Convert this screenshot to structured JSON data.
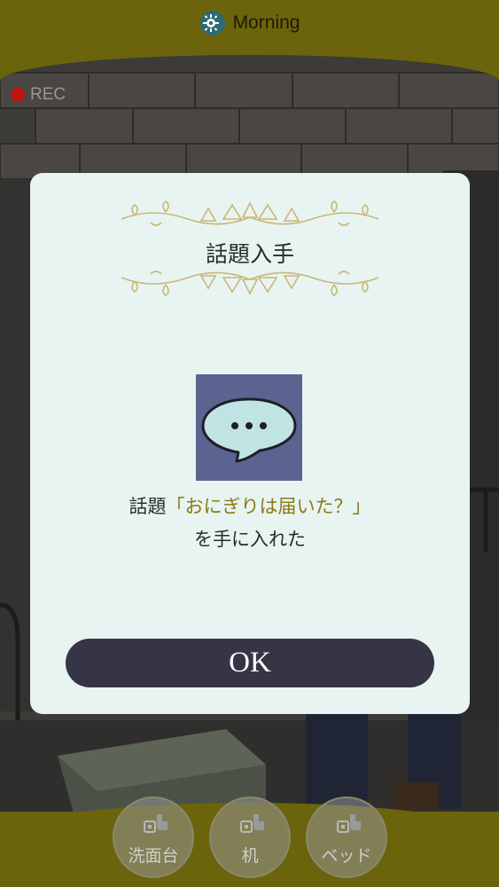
{
  "header": {
    "time_of_day": "Morning",
    "icon": "clock-gear-icon"
  },
  "recording": {
    "label": "REC",
    "dot_color": "#c21313"
  },
  "dialog": {
    "title": "話題入手",
    "icon": "speech-bubble-icon",
    "message_prefix": "話題",
    "topic_name": "「おにぎりは届いた？」",
    "message_suffix": "を手に入れた",
    "ok_label": "OK"
  },
  "locations": [
    {
      "label": "洗面台",
      "icon": "hand-tap-icon"
    },
    {
      "label": "机",
      "icon": "hand-tap-icon"
    },
    {
      "label": "ベッド",
      "icon": "hand-tap-icon"
    }
  ],
  "colors": {
    "bar": "#6b640c",
    "dialog_bg": "#e7f4f2",
    "topic_text": "#8c7a12",
    "button": "#353545",
    "icon_bg": "#5b6390"
  }
}
